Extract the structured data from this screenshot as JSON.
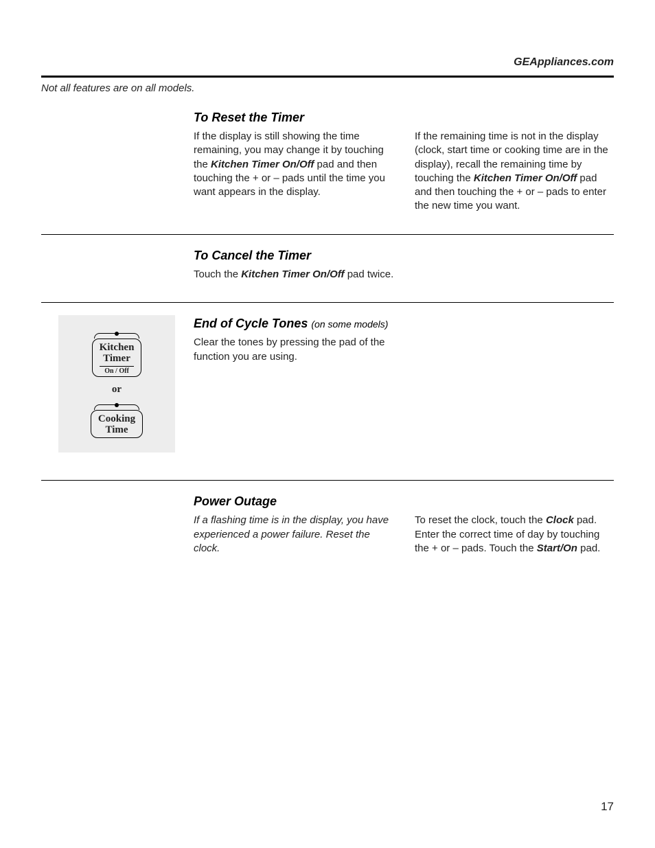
{
  "header": {
    "site": "GEAppliances.com"
  },
  "note": "Not all features are on all models.",
  "sections": {
    "reset": {
      "title": "To Reset the Timer",
      "col1_a": "If the display is still showing the time remaining, you may change it by touching the ",
      "col1_b": "Kitchen Timer On/Off",
      "col1_c": " pad and then touching the + or – pads until the time you want appears in the display.",
      "col2_a": "If the remaining time is not in the display (clock, start time or cooking time are in the display), recall the remaining time by touching the ",
      "col2_b": "Kitchen Timer On/Off",
      "col2_c": " pad and then touching the + or – pads to enter the new time you want."
    },
    "cancel": {
      "title": "To Cancel the Timer",
      "text_a": "Touch the ",
      "text_b": "Kitchen Timer On/Off",
      "text_c": " pad twice."
    },
    "tones": {
      "title": "End of Cycle Tones ",
      "subtitle": "(on some models)",
      "text": "Clear the tones by pressing the pad of the function you are using."
    },
    "figure": {
      "pad1_line1": "Kitchen",
      "pad1_line2": "Timer",
      "pad1_sub": "On / Off",
      "or": "or",
      "pad2_line1": "Cooking",
      "pad2_line2": "Time"
    },
    "power": {
      "title": "Power Outage",
      "col1": "If a flashing time is in the display, you have experienced a power failure. Reset the clock.",
      "col2_a": "To reset the clock, touch the ",
      "col2_b": "Clock",
      "col2_c": " pad. Enter the correct time of day by touching the + or – pads. Touch the ",
      "col2_d": "Start/On",
      "col2_e": " pad."
    }
  },
  "page_number": "17"
}
